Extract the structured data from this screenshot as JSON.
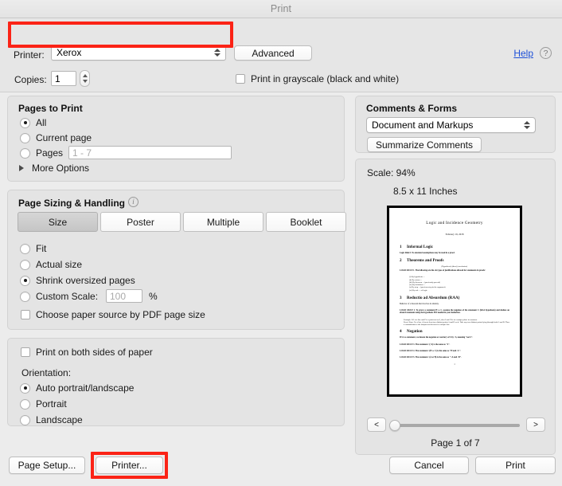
{
  "window": {
    "title": "Print"
  },
  "top": {
    "printer_label": "Printer:",
    "printer_value": "Xerox",
    "advanced_label": "Advanced",
    "help_label": "Help",
    "help_icon_glyph": "?",
    "copies_label": "Copies:",
    "copies_value": "1",
    "grayscale_label": "Print in grayscale (black and white)"
  },
  "pages_to_print": {
    "title": "Pages to Print",
    "all_label": "All",
    "current_page_label": "Current page",
    "pages_label": "Pages",
    "pages_placeholder": "1 - 7",
    "more_options_label": "More Options"
  },
  "page_sizing": {
    "title": "Page Sizing & Handling",
    "info_glyph": "i",
    "segments": [
      "Size",
      "Poster",
      "Multiple",
      "Booklet"
    ],
    "active_segment": "Size",
    "fit_label": "Fit",
    "actual_size_label": "Actual size",
    "shrink_label": "Shrink oversized pages",
    "custom_scale_label": "Custom Scale:",
    "custom_scale_placeholder": "100",
    "percent_label": "%",
    "paper_source_label": "Choose paper source by PDF page size"
  },
  "orientation": {
    "both_sides_label": "Print on both sides of paper",
    "title": "Orientation:",
    "auto_label": "Auto portrait/landscape",
    "portrait_label": "Portrait",
    "landscape_label": "Landscape"
  },
  "comments_forms": {
    "title": "Comments & Forms",
    "selected": "Document and Markups",
    "summarize_label": "Summarize Comments"
  },
  "preview": {
    "scale_label": "Scale:  94%",
    "paper_size_label": "8.5 x 11 Inches",
    "prev_glyph": "<",
    "next_glyph": ">",
    "page_indicator": "Page 1 of 7"
  },
  "document_preview": {
    "title": "Logic and Incidence Geometry",
    "date": "February 19, 2018",
    "sections": [
      {
        "num": "1",
        "heading": "Informal Logic",
        "body": "Logic Rule 0. No unstated assumptions may be used in a proof."
      },
      {
        "num": "2",
        "heading": "Theorems and Proofs",
        "centered": "(Hypothesis) (then) (conclusion).",
        "body": "LOGIC RULE 1. The following are the six types of justifications allowed for statements in proofs:",
        "items": [
          "(i) By hypothesis ...",
          "(ii) By axiom ...",
          "(iii) By theorem ... (previously proved)",
          "(iv) By definition ...",
          "(v) By step ... (previous step in the argument)",
          "(vi) By rule ... of logic."
        ]
      },
      {
        "num": "3",
        "heading": "Reductio ad Absurdum (RAA)",
        "sub": "Behavior of a theorem that involves its identity.",
        "body": "LOGIC RULE 2. To prove a statement H ⇒ C, assume the negation of the statement C (RAA hypothesis) and deduce an absurd statement using the hypothesis H if needed in your deduction.",
        "extra": "Example. If I is a line and P is a point not on I, then I and P lie in a unique plane in common.",
        "proof": "Proof. Since I is a line, it has at least two distinct points A and B on it. Take any two distinct points lying through both A and B. Thus a contradiction to the uniqueness theorem is a unique line."
      },
      {
        "num": "4",
        "heading": "Negation",
        "body": "If S is a statement, we denote the negation or contrary of S by ~S, meaning \"not S\".",
        "rules": [
          "LOGIC RULE 3. The statement ~(~S) is the same as \"S\".",
          "LOGIC RULE 4. The statement ~(H ⇒ C) is the same as \"H and ~C\".",
          "LOGIC RULE 5. The statement ~(A or B) is the same as \"~A and ~B\"."
        ]
      }
    ],
    "page_number": "1"
  },
  "bottom": {
    "page_setup_label": "Page Setup...",
    "printer_label": "Printer...",
    "cancel_label": "Cancel",
    "print_label": "Print"
  },
  "highlights": {
    "color": "#fb2316",
    "targets": [
      "printer-popup-row",
      "printer-button"
    ]
  }
}
